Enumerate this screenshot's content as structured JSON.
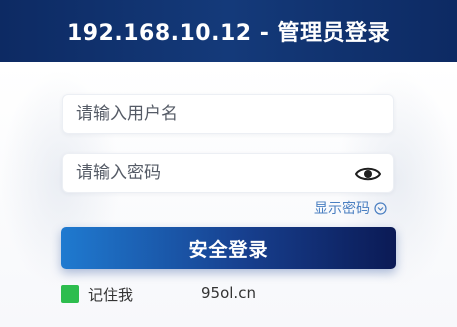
{
  "header": {
    "title": "192.168.10.12 - 管理员登录"
  },
  "form": {
    "username_placeholder": "请输入用户名",
    "password_placeholder": "请输入密码",
    "show_password_label": "显示密码",
    "login_button_label": "安全登录",
    "remember_label": "记住我"
  },
  "watermark": "95ol.cn",
  "colors": {
    "header_bg": "#0d2a63",
    "button_start": "#1f7ad0",
    "button_end": "#0b1a55",
    "link": "#4a7fc1",
    "checkbox": "#2dbd4e"
  },
  "icons": {
    "password_toggle": "eye-icon",
    "show_password": "circle-chevron-icon"
  }
}
